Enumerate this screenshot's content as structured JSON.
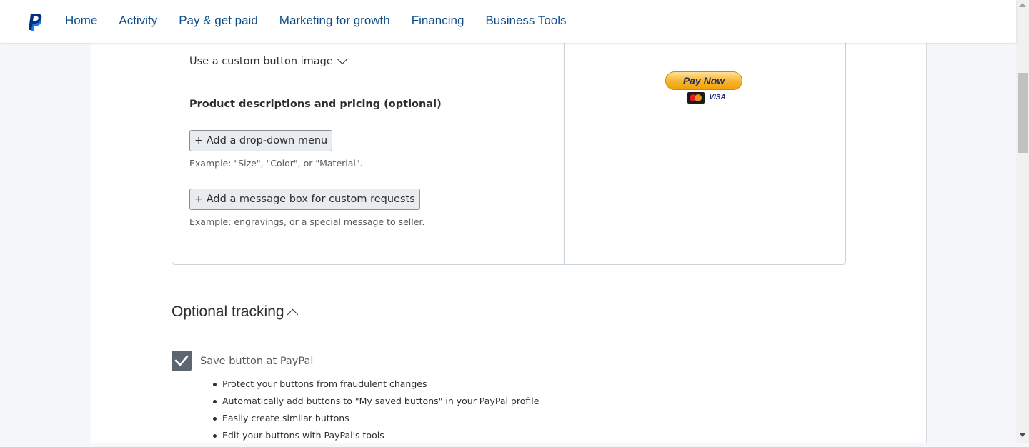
{
  "nav": {
    "logo_icon": "paypal-logo-icon",
    "links": [
      "Home",
      "Activity",
      "Pay & get paid",
      "Marketing for growth",
      "Financing",
      "Business Tools"
    ]
  },
  "form": {
    "custom_image_label": "Use a custom button image",
    "product_section_title": "Product descriptions and pricing (optional)",
    "add_dropdown_label": "+ Add a drop-down menu",
    "add_dropdown_hint": "Example: \"Size\", \"Color\", or \"Material\".",
    "add_message_label": "+ Add a message box for custom requests",
    "add_message_hint": "Example: engravings, or a special message to seller."
  },
  "preview": {
    "paynow_label": "Pay Now",
    "card_icons": [
      "mastercard-icon",
      "visa-icon"
    ],
    "visa_text": "VISA"
  },
  "tracking": {
    "title": "Optional tracking",
    "save_checkbox_checked": true,
    "save_label": "Save button at PayPal",
    "benefits": [
      "Protect your buttons from fraudulent changes",
      "Automatically add buttons to \"My saved buttons\" in your PayPal profile",
      "Easily create similar buttons",
      "Edit your buttons with PayPal's tools"
    ]
  },
  "colors": {
    "nav_link": "#0e4d8a",
    "checkbox": "#5c6670",
    "paynow_gold": "#f7b32b"
  }
}
